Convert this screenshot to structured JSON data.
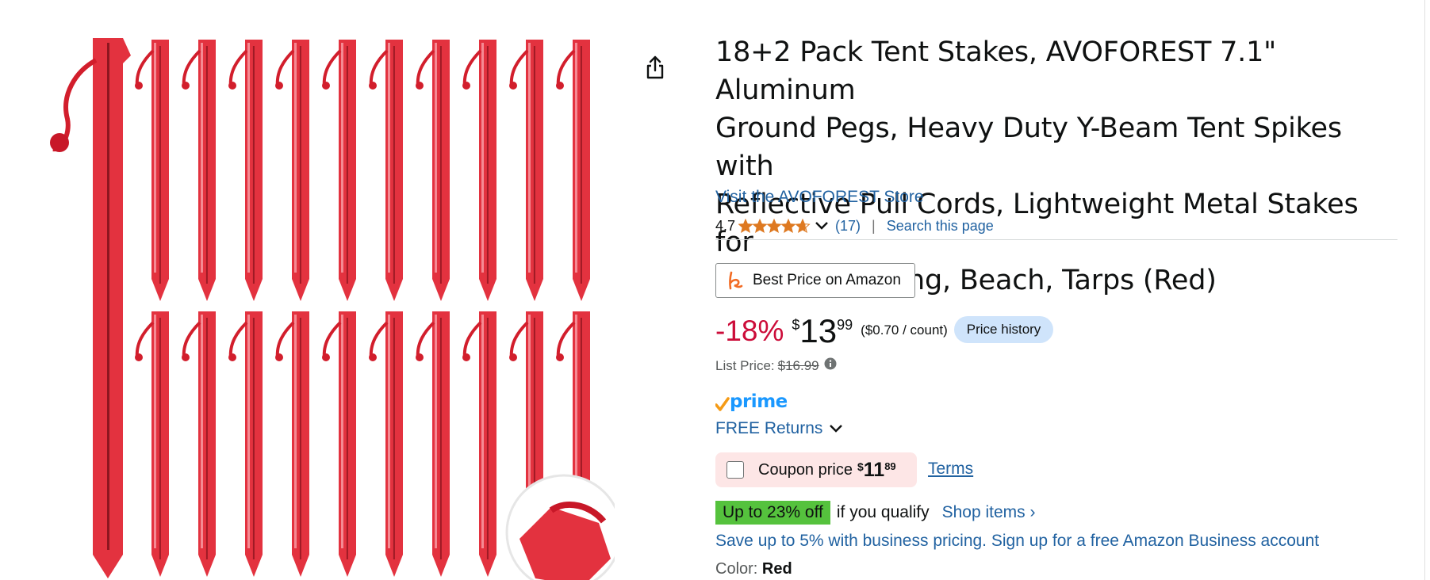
{
  "product": {
    "title": "18+2 Pack Tent Stakes, AVOFOREST 7.1\" Aluminum Ground Pegs, Heavy Duty Y-Beam Tent Spikes with Reflective Pull Cords, Lightweight Metal Stakes for Camping, Hiking, Beach, Tarps (Red)",
    "title_lines": [
      "18+2 Pack Tent Stakes, AVOFOREST 7.1\" Aluminum",
      "Ground Pegs, Heavy Duty Y-Beam Tent Spikes with",
      "Reflective Pull Cords, Lightweight Metal Stakes for",
      "Camping, Hiking, Beach, Tarps (Red)"
    ],
    "store_link": "Visit the AVOFOREST Store",
    "image_color": "#e3323f"
  },
  "rating": {
    "value": "4.7",
    "stars": 4.7,
    "count": "(17)",
    "divider": "|",
    "search_link": "Search this page"
  },
  "best_price": {
    "label": "Best Price on Amazon",
    "icon": "honey-logo-icon"
  },
  "price": {
    "discount": "-18%",
    "currency": "$",
    "whole": "13",
    "fraction": "99",
    "unit_price": "($0.70 / count)",
    "history_button": "Price history"
  },
  "list_price": {
    "label": "List Price:",
    "value": "$16.99"
  },
  "prime": {
    "label": "prime"
  },
  "returns": {
    "label": "FREE Returns"
  },
  "coupon": {
    "label": "Coupon price",
    "currency": "$",
    "whole": "11",
    "fraction": "89",
    "terms": "Terms"
  },
  "offer": {
    "badge": "Up to 23% off",
    "text": "if you qualify",
    "shop_link": "Shop items ›"
  },
  "business": {
    "text": "Save up to 5% with business pricing. Sign up for a free Amazon Business account"
  },
  "color": {
    "label": "Color:",
    "value": "Red"
  },
  "colors": {
    "link": "#2162a1",
    "deal_red": "#cc0c39",
    "star": "#de7921",
    "prime_blue": "#1a98ff",
    "badge_green": "#55c23d",
    "history_blue": "#cfe4fb",
    "coupon_pink": "#fde6e6"
  }
}
